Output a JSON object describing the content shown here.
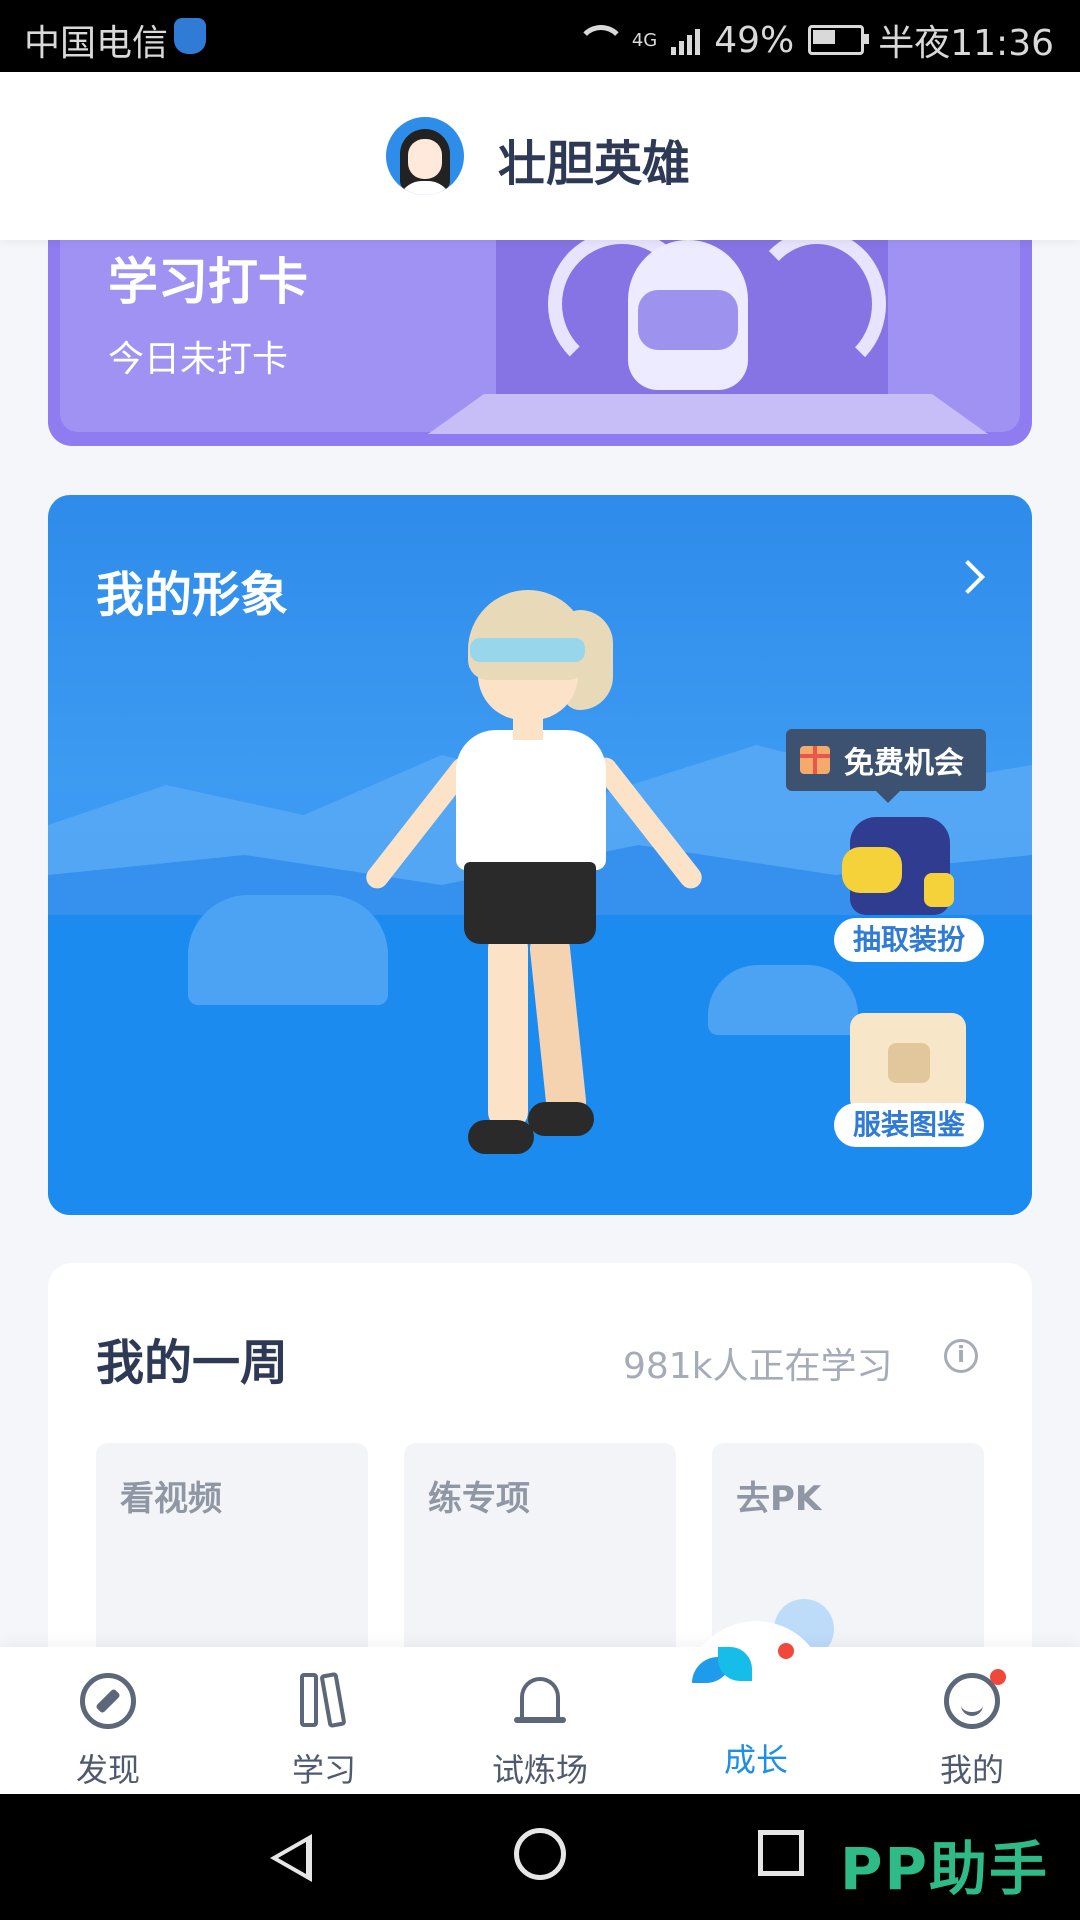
{
  "status_bar": {
    "carrier": "中国电信",
    "network": "4G",
    "battery": "49%",
    "time": "半夜11:36"
  },
  "header": {
    "title": "壮胆英雄"
  },
  "checkin": {
    "title": "学习打卡",
    "status": "今日未打卡"
  },
  "avatar_card": {
    "title": "我的形象",
    "free_chance": "免费机会",
    "draw_outfit": "抽取装扮",
    "outfit_catalog": "服装图鉴"
  },
  "week": {
    "title": "我的一周",
    "learners": "981k人正在学习",
    "tiles": [
      "看视频",
      "练专项",
      "去PK"
    ]
  },
  "bottom_nav": {
    "items": [
      "发现",
      "学习",
      "试炼场",
      "成长",
      "我的"
    ],
    "active": "成长"
  },
  "watermark": "PP助手"
}
